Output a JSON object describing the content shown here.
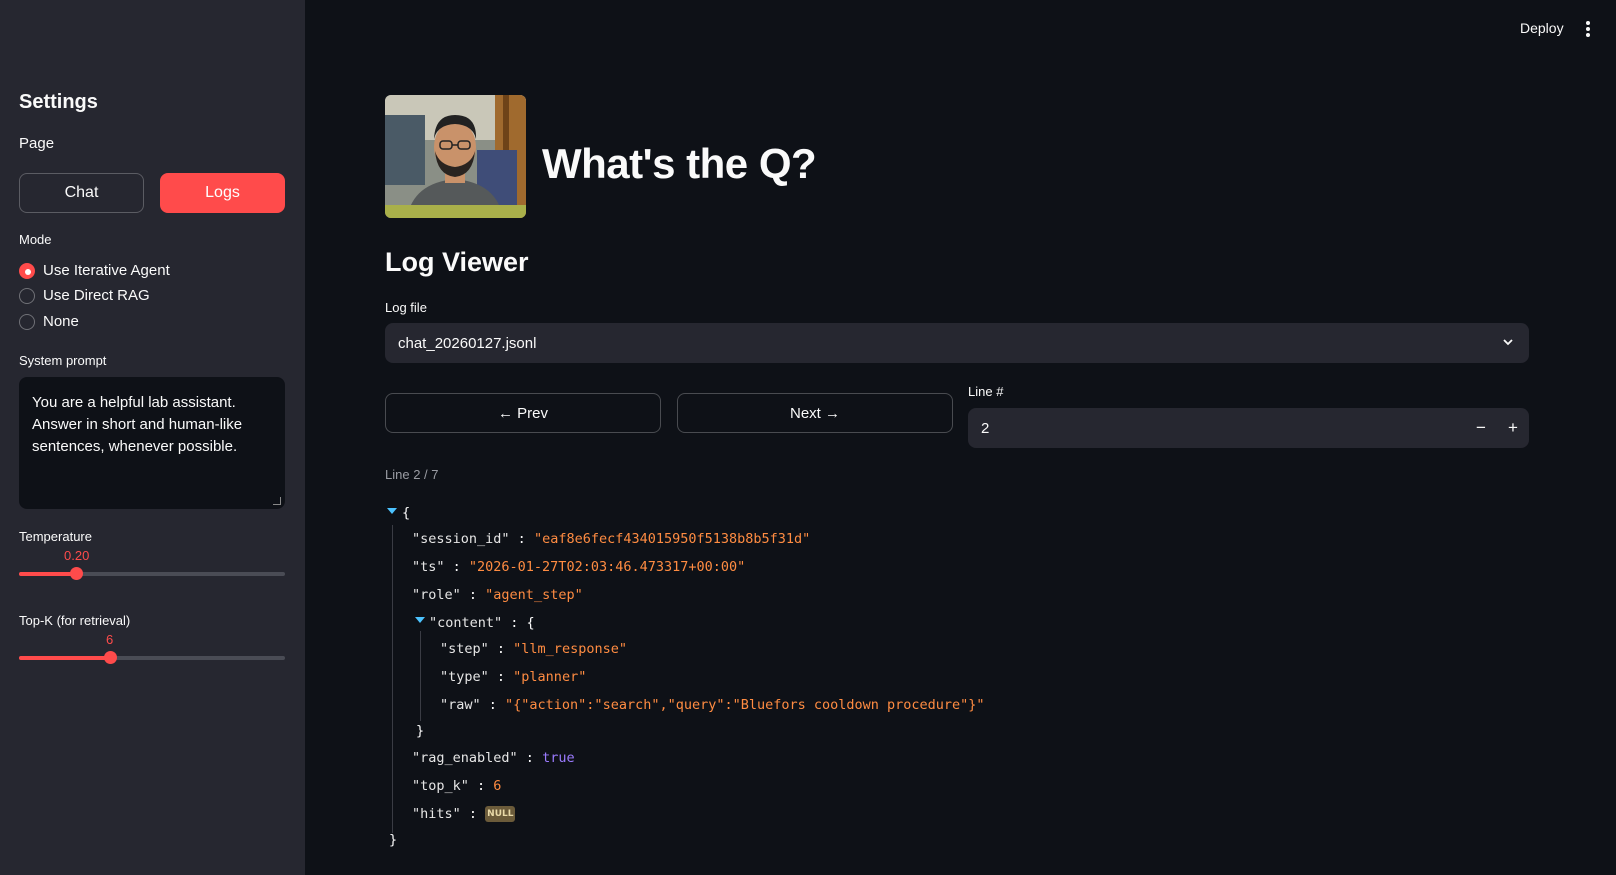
{
  "header": {
    "deploy_label": "Deploy",
    "menu_icon": "kebab-menu-icon"
  },
  "sidebar": {
    "title": "Settings",
    "page_label": "Page",
    "page_buttons": [
      {
        "label": "Chat"
      },
      {
        "label": "Logs",
        "selected": true
      }
    ],
    "mode_label": "Mode",
    "modes": [
      {
        "label": "Use Iterative Agent",
        "selected": true
      },
      {
        "label": "Use Direct RAG",
        "selected": false
      },
      {
        "label": "None",
        "selected": false
      }
    ],
    "system_prompt_label": "System prompt",
    "system_prompt": "You are a helpful lab assistant. Answer in short and human-like sentences, whenever possible.",
    "temperature": {
      "label": "Temperature",
      "value": "0.20",
      "fraction": 0.2
    },
    "topk": {
      "label": "Top-K (for retrieval)",
      "value": "6",
      "fraction": 0.35
    },
    "accent_color": "#ff4b4b"
  },
  "main": {
    "app_title": "What's the Q?",
    "section_title": "Log Viewer",
    "log_file_label": "Log file",
    "log_file_value": "chat_20260127.jsonl",
    "prev_label": "← Prev",
    "next_label": "Next →",
    "line_label": "Line #",
    "line_value": "2",
    "minus_label": "−",
    "plus_label": "+",
    "line_caption": "Line 2 / 7"
  },
  "json_view": {
    "open_brace": "{",
    "close_brace": "}",
    "session_id_key": "\"session_id\"",
    "session_id_val": "\"eaf8e6fecf434015950f5138b8b5f31d\"",
    "ts_key": "\"ts\"",
    "ts_val": "\"2026-01-27T02:03:46.473317+00:00\"",
    "role_key": "\"role\"",
    "role_val": "\"agent_step\"",
    "content_key": "\"content\"",
    "step_key": "\"step\"",
    "step_val": "\"llm_response\"",
    "type_key": "\"type\"",
    "type_val": "\"planner\"",
    "raw_key": "\"raw\"",
    "raw_val": "\"{\"action\":\"search\",\"query\":\"Bluefors cooldown procedure\"}\"",
    "rag_key": "\"rag_enabled\"",
    "rag_val": "true",
    "topk_key": "\"top_k\"",
    "topk_val": "6",
    "hits_key": "\"hits\"",
    "hits_val": "NULL",
    "colon": " : "
  }
}
